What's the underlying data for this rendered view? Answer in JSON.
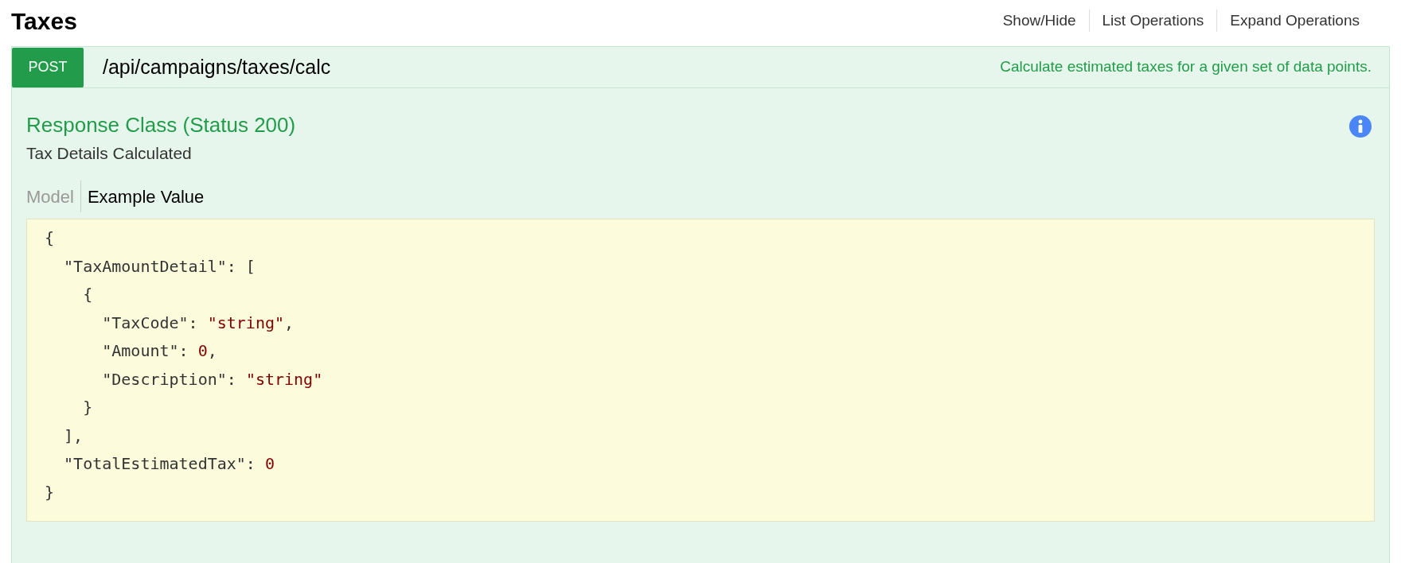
{
  "section": {
    "title": "Taxes",
    "links": [
      "Show/Hide",
      "List Operations",
      "Expand Operations"
    ]
  },
  "operation": {
    "method": "POST",
    "path": "/api/campaigns/taxes/calc",
    "summary": "Calculate estimated taxes for a given set of data points.",
    "response_class": {
      "heading": "Response Class (Status 200)",
      "description": "Tax Details Calculated"
    },
    "tabs": [
      {
        "label": "Model",
        "selected": false
      },
      {
        "label": "Example Value",
        "selected": true
      }
    ],
    "example_lines": [
      [
        {
          "kind": "punct",
          "text": "{"
        }
      ],
      [
        {
          "kind": "punct",
          "text": "  \"TaxAmountDetail\": ["
        }
      ],
      [
        {
          "kind": "punct",
          "text": "    {"
        }
      ],
      [
        {
          "kind": "punct",
          "text": "      \"TaxCode\": "
        },
        {
          "kind": "value",
          "text": "\"string\""
        },
        {
          "kind": "punct",
          "text": ","
        }
      ],
      [
        {
          "kind": "punct",
          "text": "      \"Amount\": "
        },
        {
          "kind": "value",
          "text": "0"
        },
        {
          "kind": "punct",
          "text": ","
        }
      ],
      [
        {
          "kind": "punct",
          "text": "      \"Description\": "
        },
        {
          "kind": "value",
          "text": "\"string\""
        }
      ],
      [
        {
          "kind": "punct",
          "text": "    }"
        }
      ],
      [
        {
          "kind": "punct",
          "text": "  ],"
        }
      ],
      [
        {
          "kind": "punct",
          "text": "  \"TotalEstimatedTax\": "
        },
        {
          "kind": "value",
          "text": "0"
        }
      ],
      [
        {
          "kind": "punct",
          "text": "}"
        }
      ]
    ]
  }
}
